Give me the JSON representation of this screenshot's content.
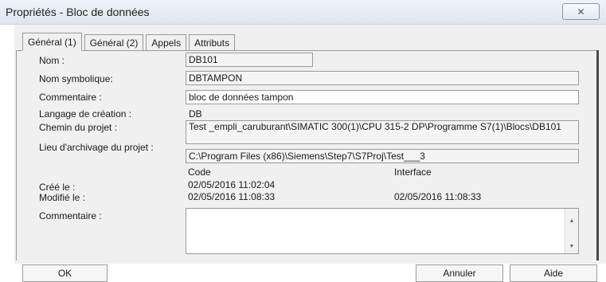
{
  "window": {
    "title": "Propriétés - Bloc de données",
    "close_glyph": "✕"
  },
  "tabs": [
    {
      "label": "Général (1)",
      "active": true
    },
    {
      "label": "Général  (2)",
      "active": false
    },
    {
      "label": "Appels",
      "active": false
    },
    {
      "label": "Attributs",
      "active": false
    }
  ],
  "fields": {
    "nom": {
      "label": "Nom :",
      "value": "DB101"
    },
    "nom_symbolique": {
      "label": "Nom symbolique:",
      "value": "DBTAMPON"
    },
    "commentaire1": {
      "label": "Commentaire :",
      "value": "bloc de données tampon"
    },
    "langage": {
      "label": "Langage de création :",
      "value": "DB"
    },
    "chemin": {
      "label": "Chemin du projet :",
      "value": "Test _empli_caruburant\\SIMATIC 300(1)\\CPU 315-2 DP\\Programme S7(1)\\Blocs\\DB101"
    },
    "lieu": {
      "label": "Lieu  d'archivage du projet :",
      "value": "C:\\Program Files (x86)\\Siemens\\Step7\\S7Proj\\Test___3"
    },
    "col_code": "Code",
    "col_interface": "Interface",
    "cree": {
      "label": "Créé le :",
      "code": "02/05/2016 11:02:04",
      "interface": ""
    },
    "modifie": {
      "label": "Modifié le :",
      "code": "02/05/2016 11:08:33",
      "interface": "02/05/2016 11:08:33"
    },
    "commentaire2": {
      "label": "Commentaire :",
      "value": ""
    }
  },
  "scroll": {
    "up_glyph": "▲",
    "down_glyph": "▼"
  },
  "buttons": {
    "ok": "OK",
    "cancel": "Annuler",
    "help": "Aide"
  }
}
